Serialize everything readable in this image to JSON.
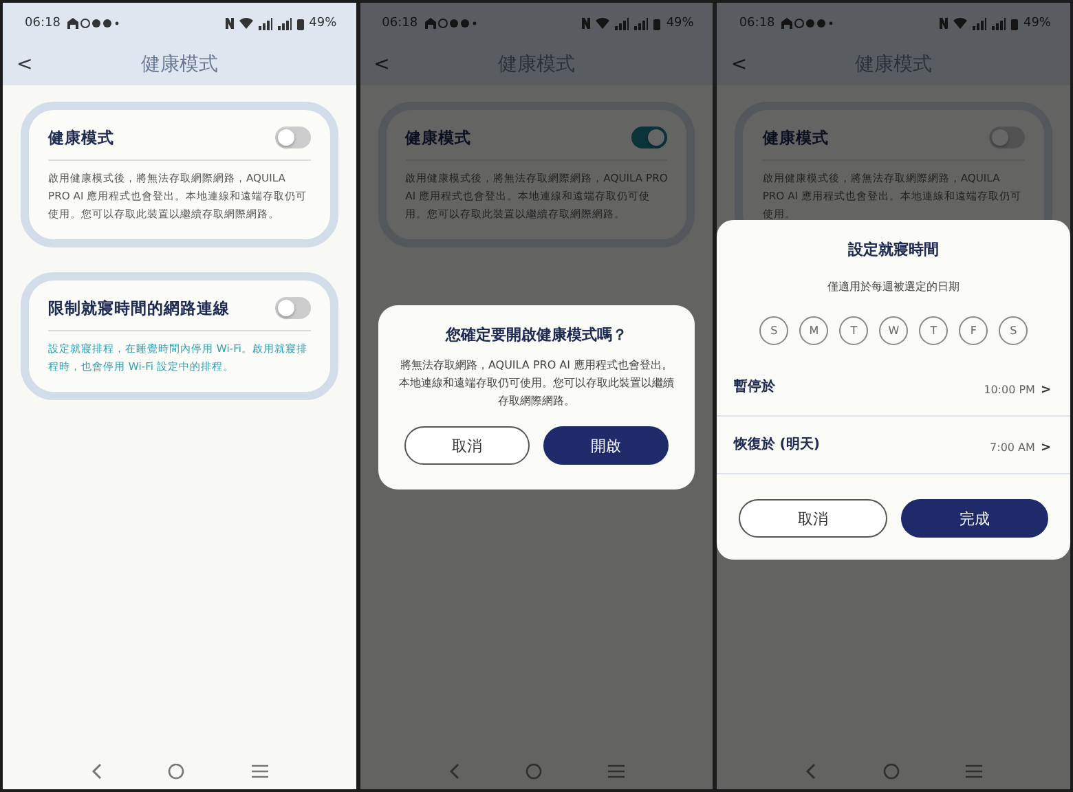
{
  "screens": [
    {
      "status_bar": {
        "time": "06:18",
        "battery": "49%"
      },
      "header": {
        "back": "<",
        "title": "健康模式"
      },
      "dimmed": false,
      "cards": [
        {
          "kind": "mode",
          "title": "健康模式",
          "on": false,
          "text": "啟用健康模式後，將無法存取網際網路，AQUILA PRO AI 應用程式也會登出。本地連線和遠端存取仍可使用。您可以存取此裝置以繼續存取網際網路。"
        },
        {
          "kind": "schedule",
          "title": "限制就寢時間的網路連線",
          "on": false,
          "text": "設定就寢排程，在睡覺時間內停用 Wi-Fi。啟用就寢排程時，也會停用 Wi-Fi 設定中的排程。"
        }
      ]
    },
    {
      "status_bar": {
        "time": "06:18",
        "battery": "49%"
      },
      "header": {
        "back": "<",
        "title": "健康模式"
      },
      "dimmed": true,
      "cards": [
        {
          "kind": "mode",
          "title": "健康模式",
          "on": true,
          "text": "啟用健康模式後，將無法存取網際網路，AQUILA PRO AI 應用程式也會登出。本地連線和遠端存取仍可使用。您可以存取此裝置以繼續存取網際網路。"
        }
      ],
      "dialog": {
        "kind": "confirm",
        "title": "您確定要開啟健康模式嗎？",
        "text": "將無法存取網路，AQUILA PRO AI 應用程式也會登出。本地連線和遠端存取仍可使用。您可以存取此裝置以繼續存取網際網路。",
        "buttons": [
          {
            "label": "取消",
            "primary": false
          },
          {
            "label": "開啟",
            "primary": true
          }
        ]
      }
    },
    {
      "status_bar": {
        "time": "06:18",
        "battery": "49%"
      },
      "header": {
        "back": "<",
        "title": "健康模式"
      },
      "dimmed": true,
      "cards": [
        {
          "kind": "mode",
          "title": "健康模式",
          "on": false,
          "text": "啟用健康模式後，將無法存取網際網路，AQUILA PRO AI 應用程式也會登出。本地連線和遠端存取仍可使用。"
        }
      ],
      "dialog": {
        "kind": "sheet",
        "title": "設定就寢時間",
        "subtitle": "僅適用於每週被選定的日期",
        "days": [
          {
            "label": "S",
            "selected": false
          },
          {
            "label": "M",
            "selected": false
          },
          {
            "label": "T",
            "selected": false
          },
          {
            "label": "W",
            "selected": false
          },
          {
            "label": "T",
            "selected": false
          },
          {
            "label": "F",
            "selected": false
          },
          {
            "label": "S",
            "selected": false
          }
        ],
        "rows": [
          {
            "label": "暫停於",
            "value": "10:00 PM",
            "arrow": ">"
          },
          {
            "label": "恢復於 (明天)",
            "value": "7:00 AM",
            "arrow": ">"
          }
        ],
        "buttons": [
          {
            "label": "取消",
            "primary": false
          },
          {
            "label": "完成",
            "primary": true
          }
        ]
      }
    }
  ]
}
